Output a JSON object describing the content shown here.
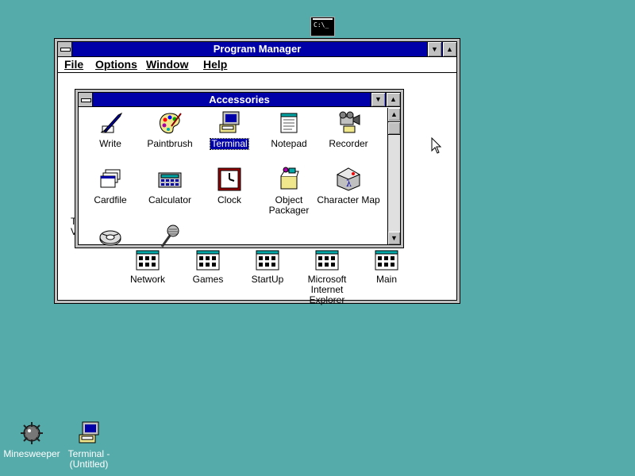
{
  "desktop": {
    "taskbar_dos_icon": "C:\\_",
    "icons": [
      {
        "label": "Minesweeper",
        "icon": "minesweeper-icon"
      },
      {
        "label": "Terminal - (Untitled)",
        "icon": "terminal-icon"
      }
    ]
  },
  "program_manager": {
    "title": "Program Manager",
    "menu": [
      "File",
      "Options",
      "Window",
      "Help"
    ],
    "groups": [
      "Network",
      "Games",
      "StartUp",
      "Microsoft Internet Explorer",
      "Main"
    ],
    "partial_text": [
      "T",
      "V"
    ]
  },
  "accessories": {
    "title": "Accessories",
    "icons": [
      {
        "label": "Write",
        "icon": "write-pen-icon"
      },
      {
        "label": "Paintbrush",
        "icon": "palette-icon"
      },
      {
        "label": "Terminal",
        "icon": "terminal-icon",
        "selected": true
      },
      {
        "label": "Notepad",
        "icon": "notepad-icon"
      },
      {
        "label": "Recorder",
        "icon": "recorder-icon"
      },
      {
        "label": "Cardfile",
        "icon": "cardfile-icon"
      },
      {
        "label": "Calculator",
        "icon": "calculator-icon"
      },
      {
        "label": "Clock",
        "icon": "clock-icon"
      },
      {
        "label": "Object Packager",
        "icon": "packager-icon"
      },
      {
        "label": "Character Map",
        "icon": "charmap-icon"
      },
      {
        "label": "",
        "icon": "media-player-icon"
      },
      {
        "label": "",
        "icon": "sound-recorder-microphone-icon"
      }
    ]
  },
  "colors": {
    "desktop": "#55aaaa",
    "titlebar": "#0000a8",
    "chrome": "#c0c0c0"
  }
}
